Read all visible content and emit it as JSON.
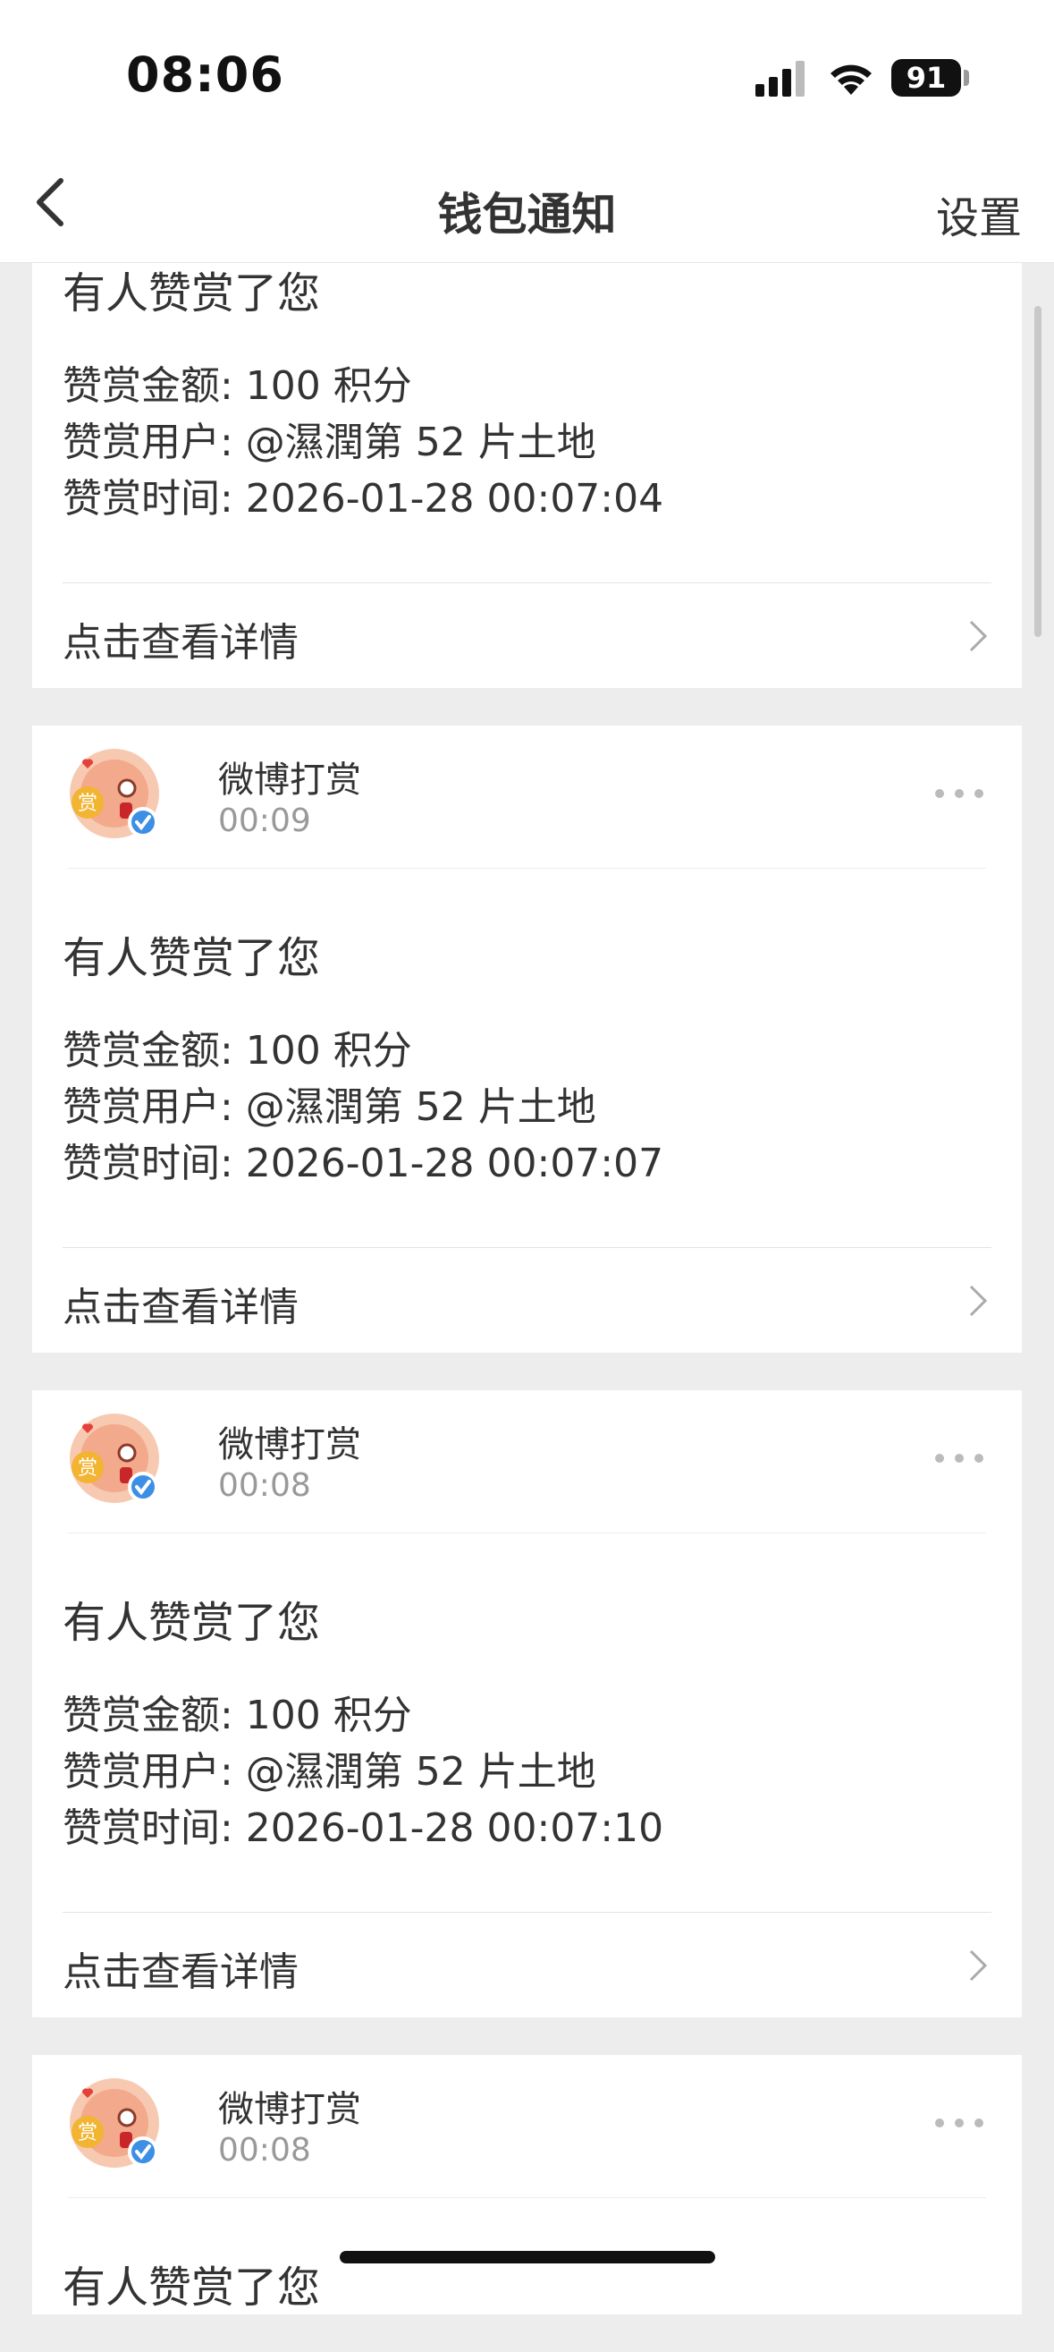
{
  "status_bar": {
    "time": "08:06",
    "battery_level": "91"
  },
  "nav": {
    "title": "钱包通知",
    "settings_label": "设置"
  },
  "cards": [
    {
      "headline": "有人赞赏了您",
      "amount": "赞赏金额: 100 积分",
      "user": "赞赏用户: @濕潤第 52 片土地",
      "time": "赞赏时间: 2026-01-28 00:07:04",
      "view_label": "点击查看详情"
    },
    {
      "sender": "微博打赏",
      "stamp": "00:09",
      "headline": "有人赞赏了您",
      "amount": "赞赏金额: 100 积分",
      "user": "赞赏用户: @濕潤第 52 片土地",
      "time": "赞赏时间: 2026-01-28 00:07:07",
      "view_label": "点击查看详情"
    },
    {
      "sender": "微博打赏",
      "stamp": "00:08",
      "headline": "有人赞赏了您",
      "amount": "赞赏金额: 100 积分",
      "user": "赞赏用户: @濕潤第 52 片土地",
      "time": "赞赏时间: 2026-01-28 00:07:10",
      "view_label": "点击查看详情"
    },
    {
      "sender": "微博打赏",
      "stamp": "00:08",
      "headline": "有人赞赏了您"
    }
  ],
  "avatar_badge": "赏",
  "icons": [
    "back-arrow-icon",
    "more-dots-icon",
    "chevron-right-icon",
    "verified-icon",
    "signal-icon",
    "wifi-icon"
  ],
  "colors": {
    "background": "#ededed",
    "card": "#ffffff",
    "text": "#333333",
    "muted": "#999999",
    "verified": "#3d8fe6"
  }
}
